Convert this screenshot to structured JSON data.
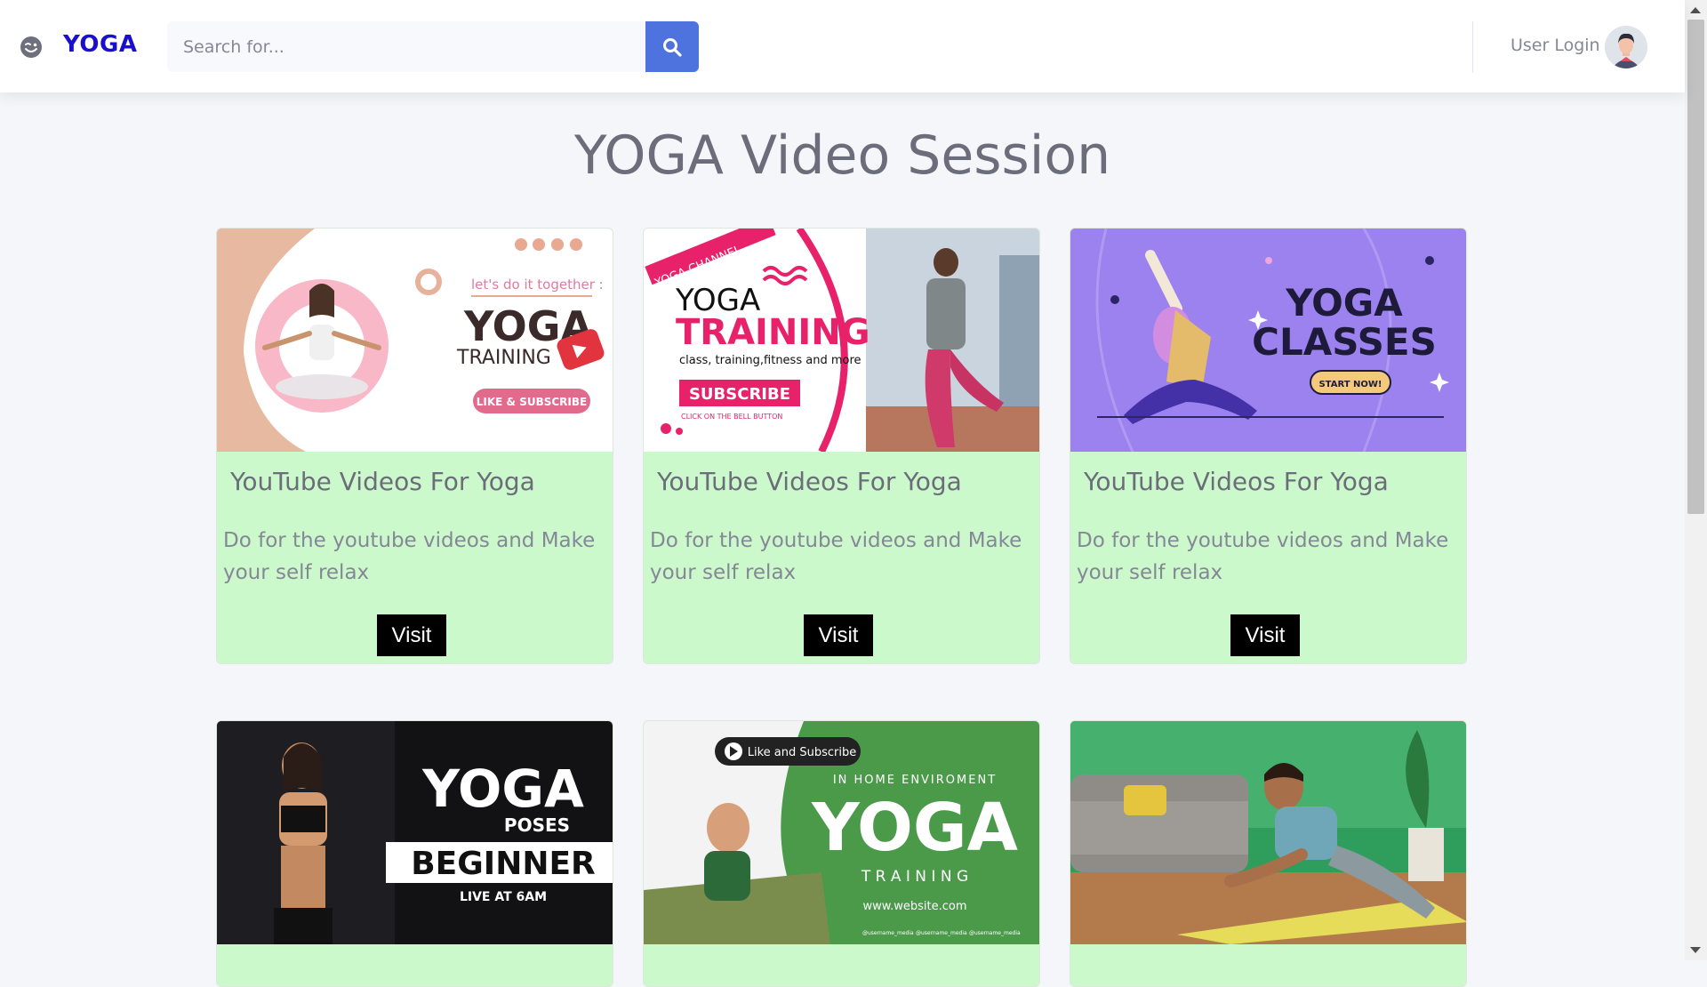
{
  "brand": {
    "name": "YOGA",
    "icon": "wink-face-icon"
  },
  "search": {
    "placeholder": "Search for...",
    "value": "",
    "button_icon": "search-icon"
  },
  "user": {
    "label": "User Login",
    "avatar": "user-avatar"
  },
  "page": {
    "title": "YOGA Video Session"
  },
  "cards": [
    {
      "title": "YouTube Videos For Yoga",
      "description": "Do for the youtube videos and Make your self relax",
      "button": "Visit",
      "thumb": {
        "line1": "let's do it together :",
        "line2": "YOGA",
        "line3": "TRAINING",
        "badge": "LIKE & SUBSCRIBE"
      }
    },
    {
      "title": "YouTube Videos For Yoga",
      "description": "Do for the youtube videos and Make your self relax",
      "button": "Visit",
      "thumb": {
        "ribbon": "YOGA CHANNEL",
        "line1": "YOGA",
        "line2": "TRAINING",
        "line3": "class, training,fitness and more",
        "badge": "SUBSCRIBE",
        "sub": "CLICK ON THE BELL BUTTON"
      }
    },
    {
      "title": "YouTube Videos For Yoga",
      "description": "Do for the youtube videos and Make your self relax",
      "button": "Visit",
      "thumb": {
        "line1": "YOGA",
        "line2": "CLASSES",
        "badge": "START NOW!"
      }
    },
    {
      "thumb": {
        "line1": "YOGA",
        "line2": "POSES",
        "line3": "BEGINNER",
        "line4": "LIVE AT 6AM"
      }
    },
    {
      "thumb": {
        "badge": "Like and Subscribe",
        "line1": "IN HOME ENVIROMENT",
        "line2": "YOGA",
        "line3": "T R A I N I N G",
        "line4": "www.website.com",
        "handles": "@username_media"
      }
    },
    {
      "thumb": {}
    }
  ],
  "colors": {
    "accent": "#4e73df",
    "brand": "#1a0fcf",
    "card_bg": "#ccf9cb",
    "button_bg": "#000000"
  }
}
